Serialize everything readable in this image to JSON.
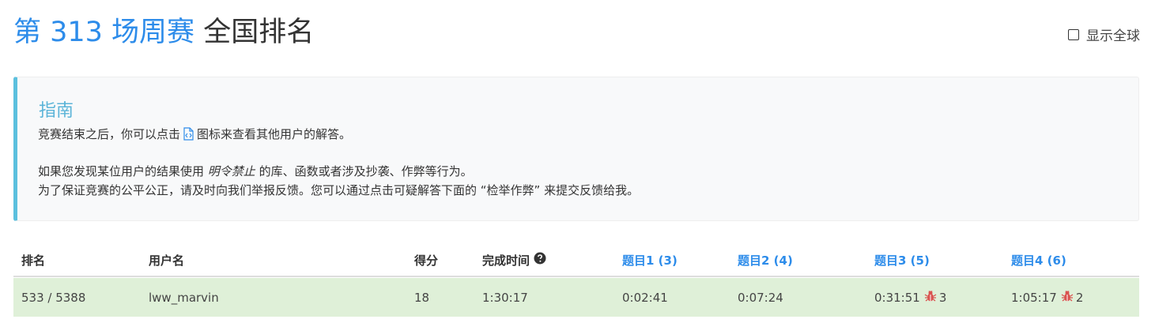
{
  "title": {
    "contest": "第 313 场周赛",
    "ranking": "全国排名"
  },
  "global_toggle": {
    "label": "显示全球",
    "checked": false
  },
  "guide": {
    "title": "指南",
    "line1_before_icon": "竞赛结束之后，你可以点击",
    "line1_after_icon": "图标来查看其他用户的解答。",
    "line2_before": "如果您发现某位用户的结果使用 ",
    "line2_em": "明令禁止",
    "line2_after": " 的库、函数或者涉及抄袭、作弊等行为。",
    "line3": "为了保证竞赛的公平公正，请及时向我们举报反馈。您可以通过点击可疑解答下面的 “检举作弊” 来提交反馈给我。",
    "icon": "code-document-icon"
  },
  "table": {
    "headers": {
      "rank": "排名",
      "username": "用户名",
      "score": "得分",
      "finish_time": "完成时间",
      "q1": "题目1 (3)",
      "q2": "题目2 (4)",
      "q3": "题目3 (5)",
      "q4": "题目4 (6)"
    },
    "row": {
      "rank": "533 / 5388",
      "username": "lww_marvin",
      "score": "18",
      "finish_time": "1:30:17",
      "q1": "0:02:41",
      "q2": "0:07:24",
      "q3_time": "0:31:51",
      "q3_penalty": "3",
      "q4_time": "1:05:17",
      "q4_penalty": "2",
      "highlight_color": "#dff0d8"
    }
  },
  "colors": {
    "accent": "#2d8cea",
    "guide_border": "#5bc0de",
    "bug": "#d9534f"
  }
}
